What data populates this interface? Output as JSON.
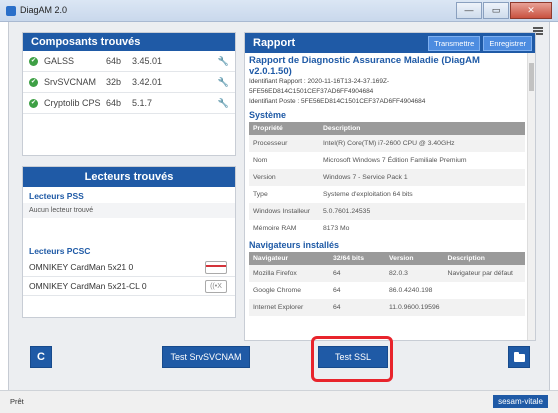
{
  "window": {
    "title": "DiagAM 2.0",
    "min_icon": "—",
    "max_icon": "▭",
    "close_icon": "✕"
  },
  "composants": {
    "title": "Composants trouvés",
    "items": [
      {
        "name": "GALSS",
        "arch": "64b",
        "version": "3.45.01"
      },
      {
        "name": "SrvSVCNAM",
        "arch": "32b",
        "version": "3.42.01"
      },
      {
        "name": "Cryptolib CPS",
        "arch": "64b",
        "version": "5.1.7"
      }
    ]
  },
  "lecteurs": {
    "title": "Lecteurs trouvés",
    "pss_title": "Lecteurs PSS",
    "pss_empty": "Aucun lecteur trouvé",
    "pcsc_title": "Lecteurs PCSC",
    "pcsc_items": [
      {
        "name": "OMNIKEY CardMan 5x21 0"
      },
      {
        "name": "OMNIKEY CardMan 5x21-CL 0",
        "icon_text": "((•X"
      }
    ]
  },
  "rapport": {
    "title": "Rapport",
    "btn_transmettre": "Transmettre",
    "btn_enregistrer": "Enregistrer",
    "heading": "Rapport de Diagnostic Assurance Maladie (DiagAM v2.0.1.50)",
    "meta_line1": "Identifiant Rapport : 2020-11-16T13-24-37.169Z-",
    "meta_line2": "5FE56ED814C1501CEF37AD6FF4904684",
    "meta_line3": "Identifiant Poste : 5FE56ED814C1501CEF37AD6FF4904684",
    "systeme_title": "Système",
    "systeme_cols": [
      "Propriété",
      "Description"
    ],
    "systeme_rows": [
      [
        "Processeur",
        "Intel(R) Core(TM) i7-2600 CPU @ 3.40GHz"
      ],
      [
        "Nom",
        "Microsoft Windows 7 Édition Familiale Premium"
      ],
      [
        "Version",
        "Windows 7 - Service Pack 1"
      ],
      [
        "Type",
        "Systeme d'exploitation 64 bits"
      ],
      [
        "Windows Installeur",
        "5.0.7601.24535"
      ],
      [
        "Mémoire RAM",
        "8173 Mo"
      ]
    ],
    "nav_title": "Navigateurs installés",
    "nav_cols": [
      "Navigateur",
      "32/64 bits",
      "Version",
      "Description"
    ],
    "nav_rows": [
      [
        "Mozilla Firefox",
        "64",
        "82.0.3",
        "Navigateur par défaut"
      ],
      [
        "Google Chrome",
        "64",
        "86.0.4240.198",
        ""
      ],
      [
        "Internet Explorer",
        "64",
        "11.0.9600.19596",
        ""
      ]
    ]
  },
  "buttons": {
    "refresh_icon": "C",
    "test_srv": "Test SrvSVCNAM",
    "test_ssl": "Test SSL"
  },
  "status": {
    "text": "Prêt",
    "brand": "sesam-vitale"
  }
}
